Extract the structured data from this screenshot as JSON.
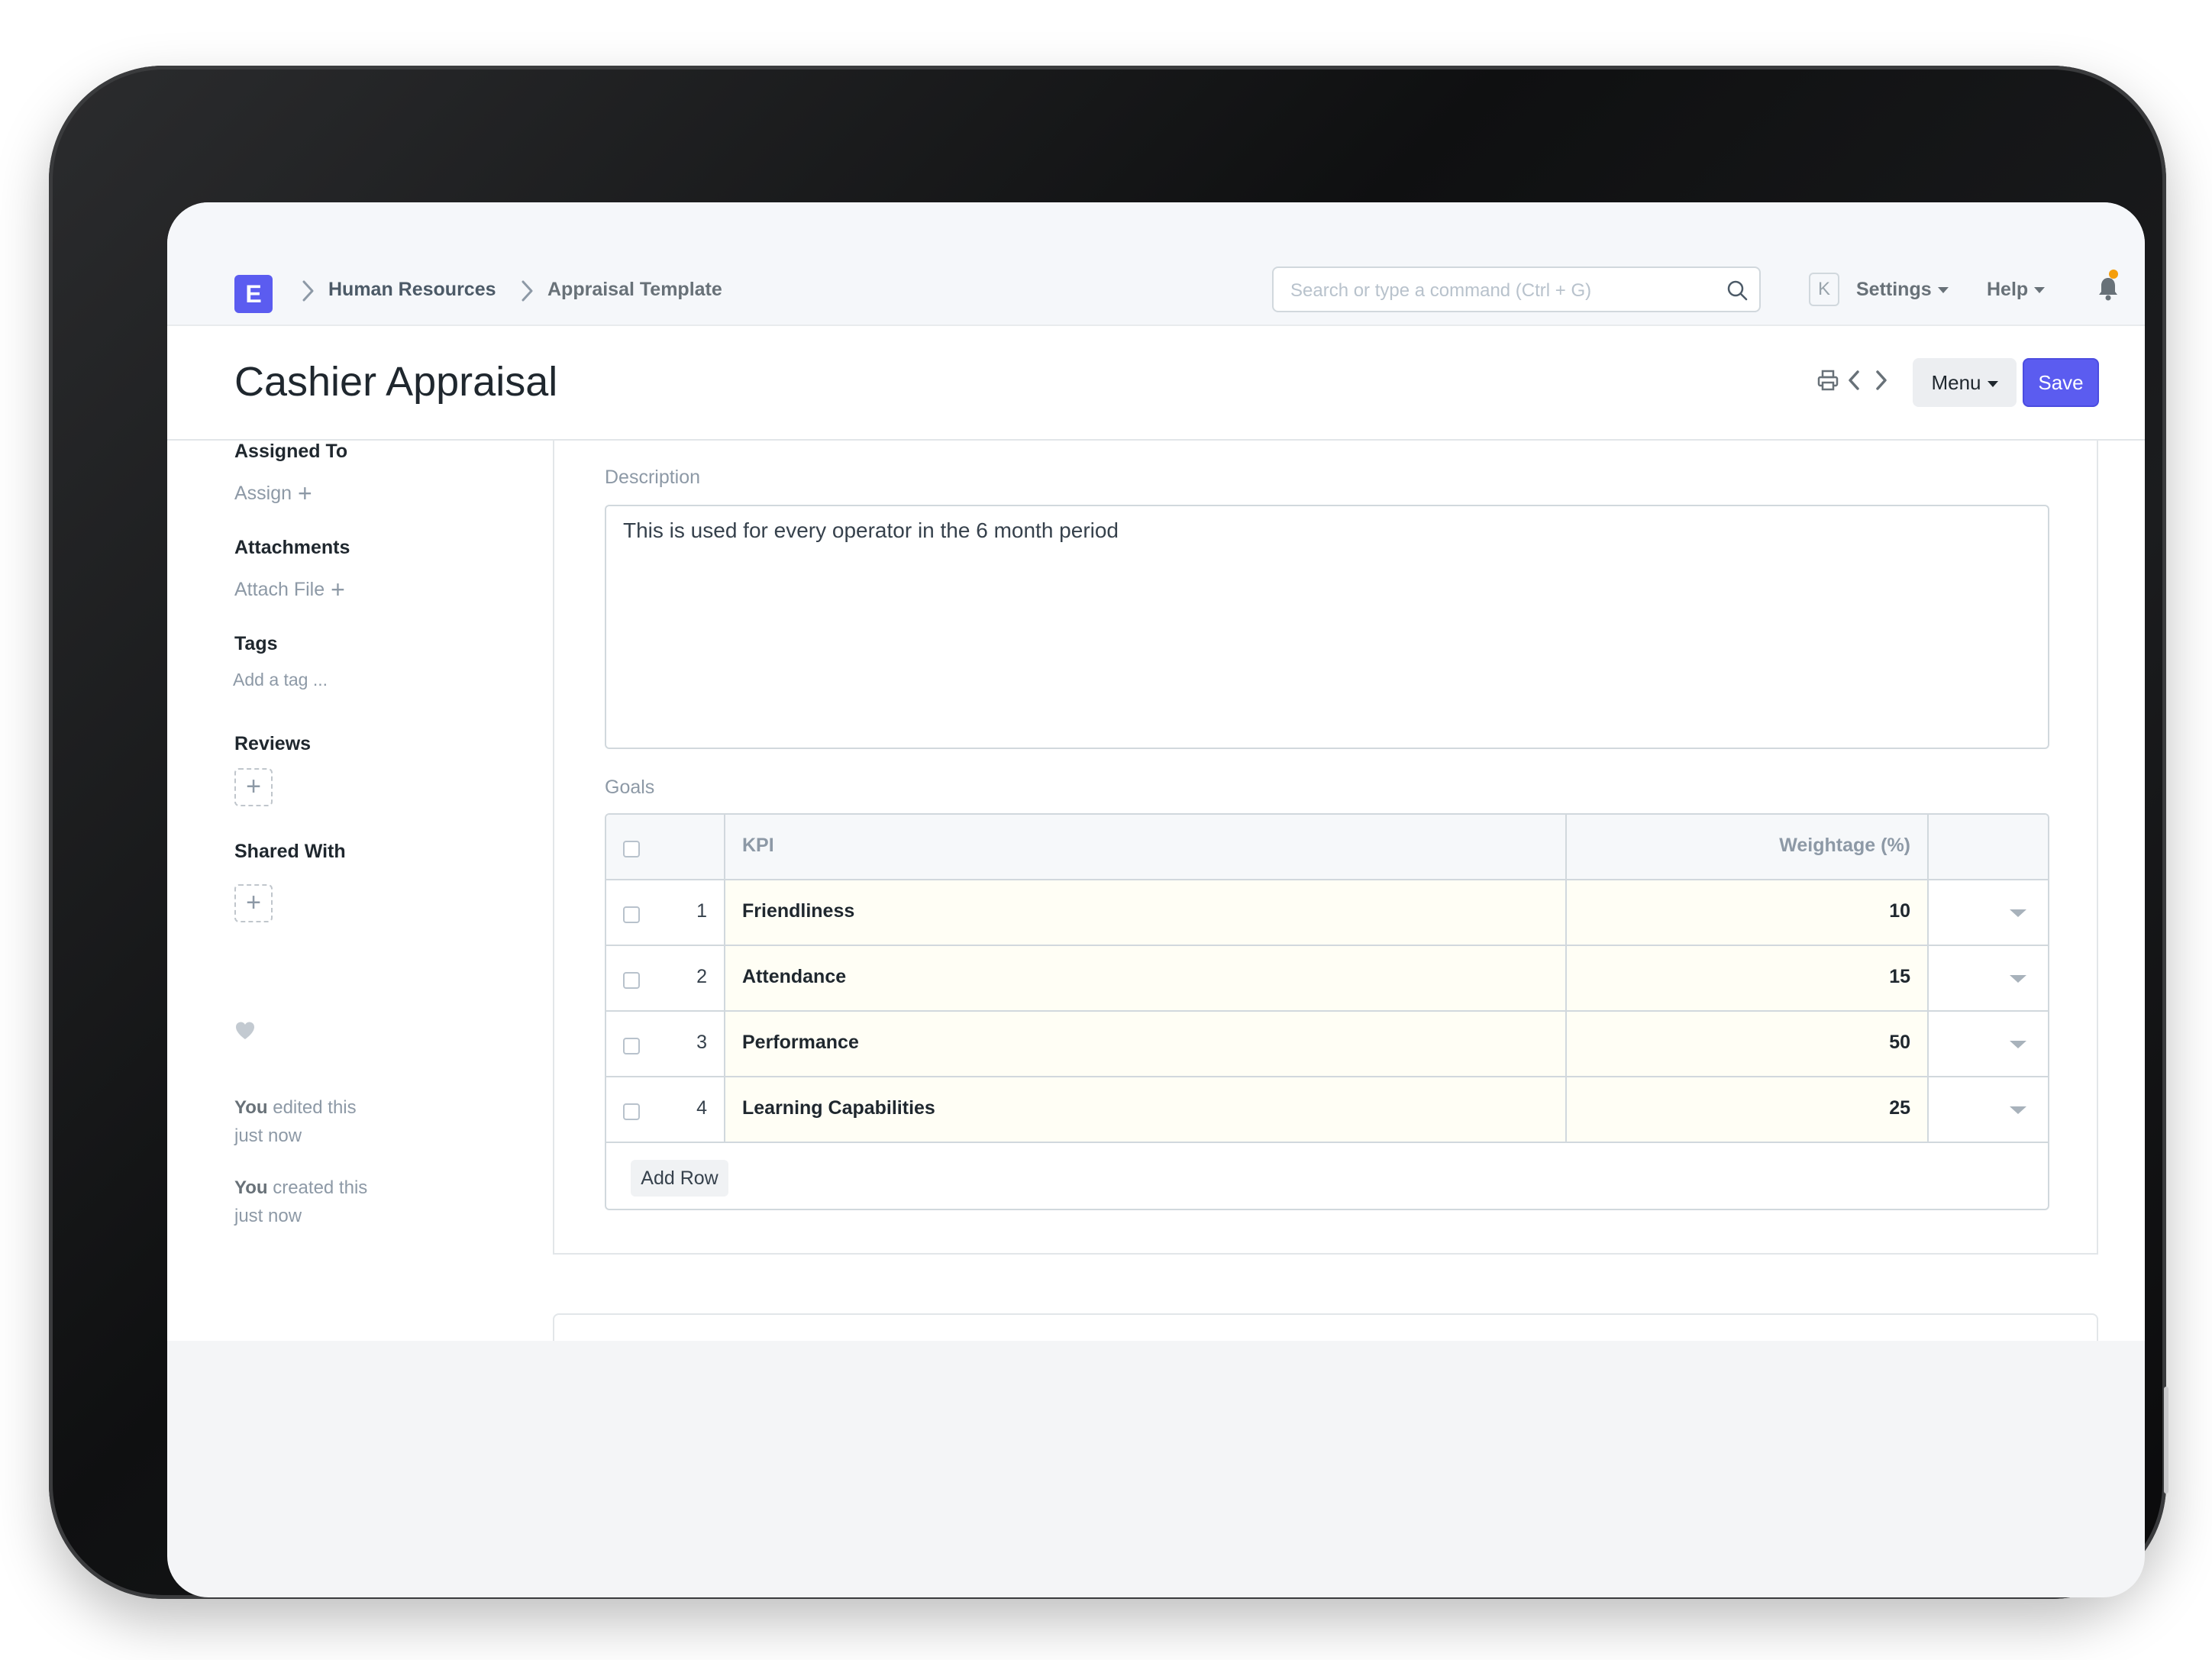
{
  "navbar": {
    "logo_letter": "E",
    "breadcrumbs": [
      "Human Resources",
      "Appraisal Template"
    ],
    "search_placeholder": "Search or type a command (Ctrl + G)",
    "avatar_initial": "K",
    "settings_label": "Settings",
    "help_label": "Help"
  },
  "page": {
    "title": "Cashier Appraisal",
    "menu_label": "Menu",
    "save_label": "Save"
  },
  "sidebar": {
    "assigned_to_label": "Assigned To",
    "assign_link": "Assign",
    "attachments_label": "Attachments",
    "attach_link": "Attach File",
    "tags_label": "Tags",
    "tag_placeholder": "Add a tag ...",
    "reviews_label": "Reviews",
    "shared_with_label": "Shared With",
    "activity": [
      {
        "who": "You",
        "action": " edited this",
        "when": "just now"
      },
      {
        "who": "You",
        "action": " created this",
        "when": "just now"
      }
    ]
  },
  "form": {
    "description_label": "Description",
    "description_value": "This is used for every operator in the 6 month period",
    "goals_label": "Goals",
    "goals_columns": [
      "KPI",
      "Weightage (%)"
    ],
    "goals_rows": [
      {
        "no": "1",
        "kpi": "Friendliness",
        "weightage": "10"
      },
      {
        "no": "2",
        "kpi": "Attendance",
        "weightage": "15"
      },
      {
        "no": "3",
        "kpi": "Performance",
        "weightage": "50"
      },
      {
        "no": "4",
        "kpi": "Learning Capabilities",
        "weightage": "25"
      }
    ],
    "add_row_label": "Add Row"
  },
  "colors": {
    "primary": "#5b5cf0",
    "notification_dot": "#f59e0b",
    "row_highlight": "#fffef5"
  }
}
